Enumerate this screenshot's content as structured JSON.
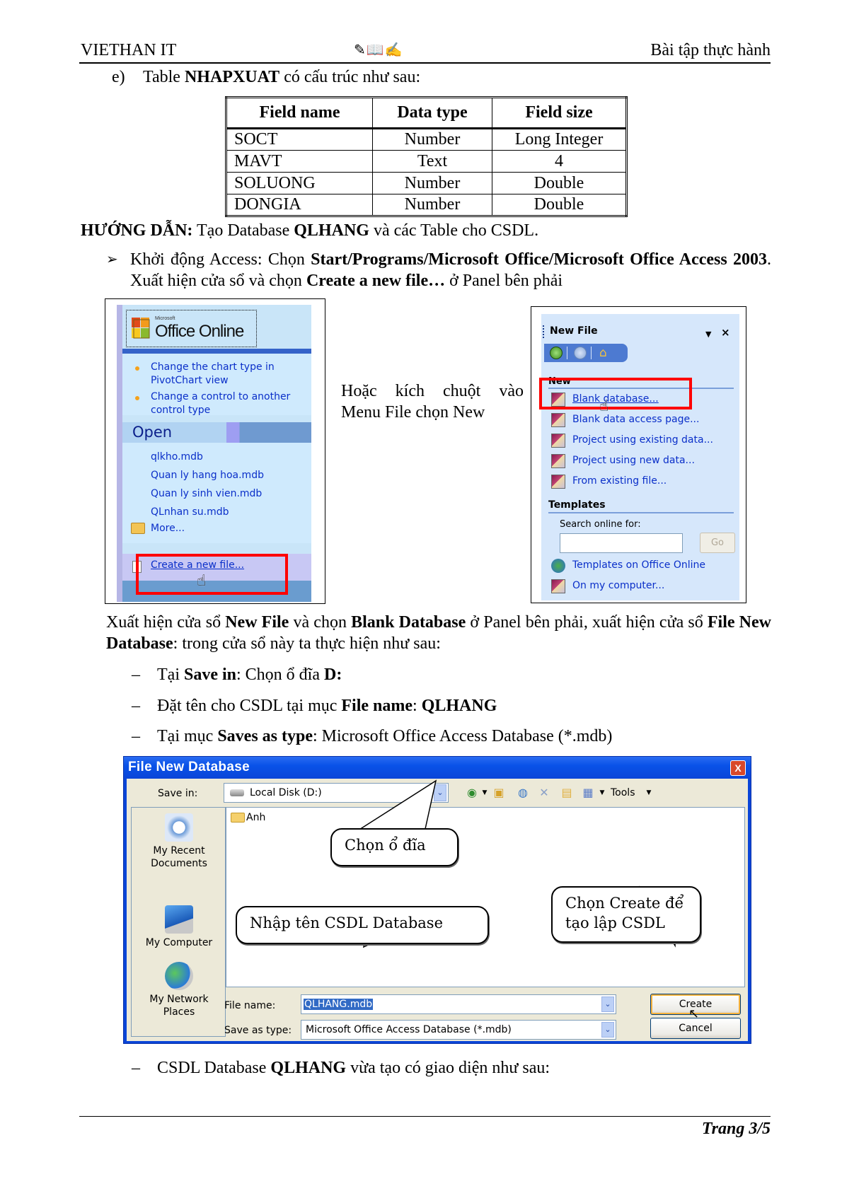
{
  "header": {
    "left": "VIETHAN IT",
    "center_icons": "✎📖✍",
    "right": "Bài tập thực hành"
  },
  "section_e": {
    "marker": "e)",
    "prefix": "Table ",
    "table_name": "NHAPXUAT",
    "suffix": " có cấu trúc như sau:"
  },
  "structure_table": {
    "columns": [
      "Field name",
      "Data type",
      "Field size"
    ],
    "rows": [
      [
        "SOCT",
        "Number",
        "Long Integer"
      ],
      [
        "MAVT",
        "Text",
        "4"
      ],
      [
        "SOLUONG",
        "Number",
        "Double"
      ],
      [
        "DONGIA",
        "Number",
        "Double"
      ]
    ]
  },
  "guide": {
    "label": "HƯỚNG DẪN:",
    "text_a": " Tạo Database ",
    "db_name": "QLHANG",
    "text_b": " và các Table cho CSDL."
  },
  "step1": {
    "bullet": "➢",
    "text_a": "Khởi động Access: Chọn ",
    "path": "Start/Programs/Microsoft Office/Microsoft Office Access 2003",
    "text_b": ". Xuất hiện cửa sổ và chọn ",
    "action": "Create a new file…",
    "text_c": " ở Panel bên phải"
  },
  "office_panel": {
    "logo_small": "Microsoft",
    "logo": "Office Online",
    "tips": [
      "Change the chart type in",
      "PivotChart view",
      "Change a control to another",
      "control type"
    ],
    "open_header": "Open",
    "recent_files": [
      "qlkho.mdb",
      "Quan ly hang hoa.mdb",
      "Quan ly sinh vien.mdb",
      "QLnhan su.mdb"
    ],
    "more": "More...",
    "create_link": "Create a new file..."
  },
  "middle_text": "Hoặc kích chuột vào Menu File chọn New",
  "new_file_panel": {
    "title": "New File",
    "new_section": "New",
    "items": [
      "Blank database...",
      "Blank data access page...",
      "Project using existing data...",
      "Project using new data...",
      "From existing file..."
    ],
    "templates_section": "Templates",
    "search_label": "Search online for:",
    "search_value": "",
    "go_button": "Go",
    "template_links": [
      "Templates on Office Online",
      "On my computer..."
    ]
  },
  "para2": {
    "text_a": "Xuất hiện cửa sổ ",
    "b1": "New File",
    "text_b": " và chọn ",
    "b2": "Blank Database",
    "text_c": " ở Panel bên phải, xuất hiện cửa sổ ",
    "b3": "File New Database",
    "text_d": ": trong cửa sổ này ta thực hiện như sau:"
  },
  "dash_items": [
    {
      "dash": "–",
      "text_a": "Tại ",
      "bold": "Save in",
      "text_b": ": Chọn ổ đĩa ",
      "bold2": "D:"
    },
    {
      "dash": "–",
      "text_a": "Đặt tên cho CSDL tại mục ",
      "bold": "File name",
      "text_b": ": ",
      "bold2": "QLHANG"
    },
    {
      "dash": "–",
      "text_a": "Tại mục ",
      "bold": "Saves as type",
      "text_b": ": Microsoft Office Access Database (*.mdb)",
      "bold2": ""
    }
  ],
  "dialog": {
    "title": "File New Database",
    "close": "X",
    "save_in_label": "Save in:",
    "save_in_value": "Local Disk (D:)",
    "tools_label": "Tools",
    "places": [
      "My Recent Documents",
      "My Computer",
      "My Network Places"
    ],
    "folders": [
      "Anh"
    ],
    "file_name_label": "File name:",
    "file_name_value": "QLHANG.mdb",
    "save_type_label": "Save as type:",
    "save_type_value": "Microsoft Office Access Database (*.mdb)",
    "create_button": "Create",
    "cancel_button": "Cancel",
    "callouts": {
      "drive": "Chọn ổ đĩa",
      "name": "Nhập tên CSDL Database",
      "create": "Chọn  Create để tạo lập CSDL"
    }
  },
  "last_item": {
    "dash": "–",
    "text_a": "CSDL Database ",
    "bold": "QLHANG",
    "text_b": " vừa tạo có giao diện như sau:"
  },
  "footer": {
    "page": "Trang 3/5"
  }
}
